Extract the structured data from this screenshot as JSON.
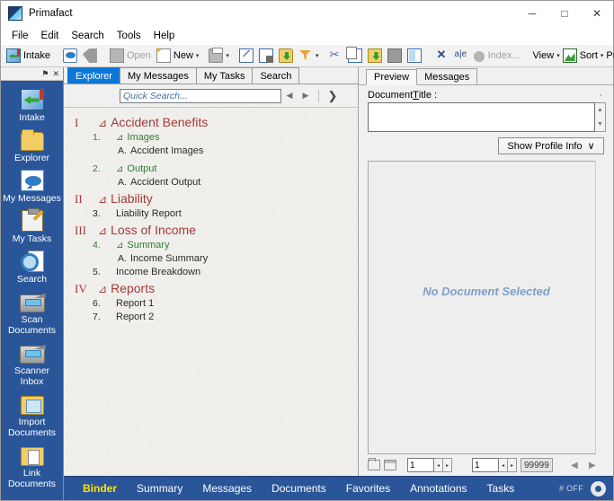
{
  "window": {
    "title": "Primafact",
    "icon": "app-logo-icon",
    "controls": {
      "minimize": "─",
      "maximize": "□",
      "close": "✕"
    }
  },
  "menu": {
    "items": [
      {
        "label": "File",
        "name": "menu-file"
      },
      {
        "label": "Edit",
        "name": "menu-edit"
      },
      {
        "label": "Search",
        "name": "menu-search"
      },
      {
        "label": "Tools",
        "name": "menu-tools"
      },
      {
        "label": "Help",
        "name": "menu-help"
      }
    ]
  },
  "toolbar": {
    "intake_label": "Intake",
    "open_label": "Open",
    "new_label": "New",
    "index_label": "Index...",
    "view_label": "View",
    "sort_label": "Sort",
    "productions_label": "Productions",
    "dropdown_caret": "▾",
    "icons": [
      "intake-icon",
      "bubble-icon",
      "tag-icon",
      "open-icon",
      "new-document-icon",
      "print-icon",
      "mail-icon",
      "mail-properties-icon",
      "folder-download-icon",
      "filter-icon",
      "cut-icon",
      "copy-icon",
      "paste-icon",
      "duplicate-icon",
      "document-pages-icon",
      "delete-icon",
      "rename-icon",
      "index-icon",
      "view-icon",
      "sort-icon",
      "misc-icon"
    ]
  },
  "sidebar": {
    "pin_icon": "⚑",
    "close_icon": "✕",
    "items": [
      {
        "label": "Intake",
        "icon": "intake-icon",
        "name": "sidebar-item-intake"
      },
      {
        "label": "Explorer",
        "icon": "folder-icon",
        "name": "sidebar-item-explorer"
      },
      {
        "label": "My Messages",
        "icon": "message-bubble-icon",
        "name": "sidebar-item-my-messages"
      },
      {
        "label": "My Tasks",
        "icon": "clipboard-pencil-icon",
        "name": "sidebar-item-my-tasks"
      },
      {
        "label": "Search",
        "icon": "magnifier-document-icon",
        "name": "sidebar-item-search"
      },
      {
        "label": "Scan\nDocuments",
        "icon": "scanner-icon",
        "name": "sidebar-item-scan-documents"
      },
      {
        "label": "Scanner Inbox",
        "icon": "scanner-icon",
        "name": "sidebar-item-scanner-inbox"
      },
      {
        "label": "Import\nDocuments",
        "icon": "folder-image-icon",
        "name": "sidebar-item-import-documents"
      },
      {
        "label": "Link\nDocuments",
        "icon": "folder-document-icon",
        "name": "sidebar-item-link-documents"
      }
    ]
  },
  "tabs": {
    "items": [
      {
        "label": "Explorer",
        "active": true
      },
      {
        "label": "My Messages",
        "active": false
      },
      {
        "label": "My Tasks",
        "active": false
      },
      {
        "label": "Search",
        "active": false
      }
    ]
  },
  "search": {
    "placeholder": "Quick Search...",
    "value": "",
    "prev_icon": "◀",
    "next_icon": "▶",
    "go_icon": "❯"
  },
  "tree": {
    "collapse_glyph": "⊿",
    "rows": [
      {
        "level": 1,
        "number": "I",
        "text": "Accident Benefits",
        "color": "red",
        "glyph": true
      },
      {
        "level": 2,
        "number": "1.",
        "text": "Images",
        "color": "green",
        "glyph": true
      },
      {
        "level": 3,
        "number": "A.",
        "text": "Accident Images",
        "color": "dark",
        "glyph": false
      },
      {
        "level": 2,
        "number": "2.",
        "text": "Output",
        "color": "green",
        "glyph": true
      },
      {
        "level": 3,
        "number": "A.",
        "text": "Accident Output",
        "color": "dark",
        "glyph": false
      },
      {
        "level": 1,
        "number": "II",
        "text": "Liability",
        "color": "red",
        "glyph": true
      },
      {
        "level": 2,
        "number": "3.",
        "text": "Liability Report",
        "color": "dark",
        "glyph": false
      },
      {
        "level": 1,
        "number": "III",
        "text": "Loss of Income",
        "color": "red",
        "glyph": true
      },
      {
        "level": 2,
        "number": "4.",
        "text": "Summary",
        "color": "green",
        "glyph": true
      },
      {
        "level": 3,
        "number": "A.",
        "text": "Income Summary",
        "color": "dark",
        "glyph": false
      },
      {
        "level": 2,
        "number": "5.",
        "text": "Income Breakdown",
        "color": "dark",
        "glyph": false
      },
      {
        "level": 1,
        "number": "IV",
        "text": "Reports",
        "color": "red",
        "glyph": true
      },
      {
        "level": 2,
        "number": "6.",
        "text": "Report 1",
        "color": "dark",
        "glyph": false
      },
      {
        "level": 2,
        "number": "7.",
        "text": "Report 2",
        "color": "dark",
        "glyph": false
      }
    ]
  },
  "preview": {
    "tabs": [
      {
        "label": "Preview",
        "active": true
      },
      {
        "label": "Messages",
        "active": false
      }
    ],
    "document_title_label_a": "Document ",
    "document_title_label_b": "T",
    "document_title_label_c": "itle :",
    "document_title_value": "",
    "corner_dot": "·",
    "show_profile_label": "Show Profile Info",
    "show_profile_caret": "∨",
    "no_document_text": "No Document Selected",
    "pager": {
      "folder_icon": "folder-outline-icon",
      "window_icon": "window-outline-icon",
      "page_value": "1",
      "doc_value": "1",
      "total_value": "99999",
      "spin_up": "◂",
      "spin_down": "▸",
      "prev_icon": "◀",
      "next_icon": "▶"
    }
  },
  "bottom": {
    "tabs": [
      {
        "label": "Binder",
        "active": true
      },
      {
        "label": "Summary",
        "active": false
      },
      {
        "label": "Messages",
        "active": false
      },
      {
        "label": "Documents",
        "active": false
      },
      {
        "label": "Favorites",
        "active": false
      },
      {
        "label": "Annotations",
        "active": false
      },
      {
        "label": "Tasks",
        "active": false
      }
    ],
    "status": "# OFF",
    "gear_icon": "gear-icon"
  },
  "colors": {
    "brand_blue": "#2a5699",
    "tab_active_blue": "#0a78d7",
    "binder_yellow": "#ffe400",
    "tree_red": "#a33a3a",
    "tree_green": "#2e7d32",
    "placeholder_blue": "#7f9fc9"
  }
}
